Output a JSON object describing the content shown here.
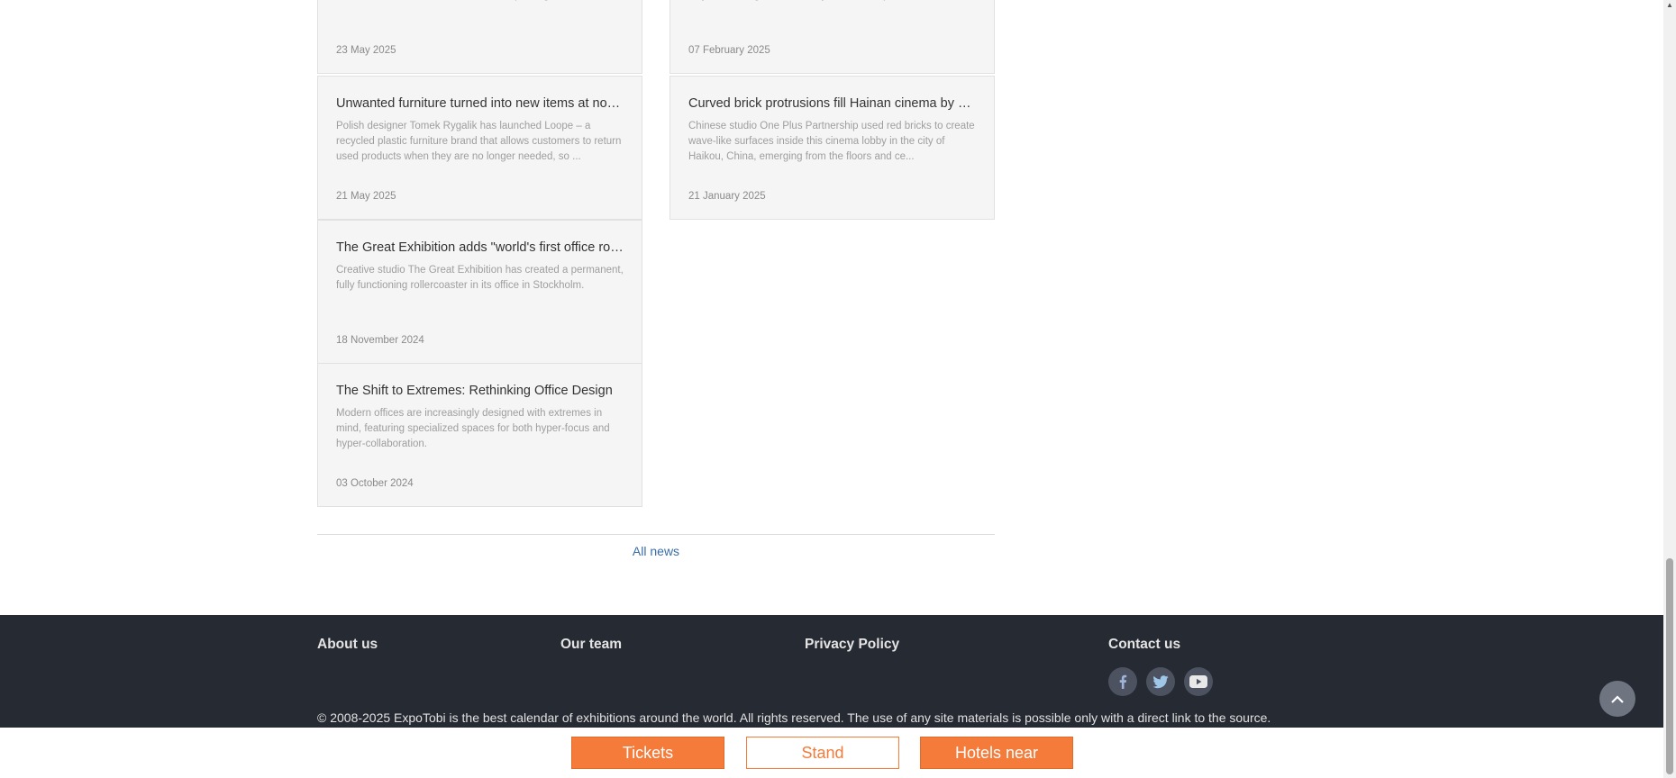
{
  "news": {
    "left_column": [
      {
        "title": "",
        "description": "built her \"plant pavilion,\" which she has turned into a guest bedroom at her summerhouse near Copenhagen.",
        "date": "23 May 2025"
      },
      {
        "title": "Unwanted furniture turned into new items at no e...",
        "description": "Polish designer Tomek Rygalik has launched Loope – a recycled plastic furniture brand that allows customers to return used products when they are no longer needed, so ...",
        "date": "21 May 2025"
      },
      {
        "title": "The Great Exhibition adds \"world's first office rolle...",
        "description": "Creative studio The Great Exhibition has created a permanent, fully functioning rollercoaster in its office in Stockholm.",
        "date": "18 November 2024"
      },
      {
        "title": "The Shift to Extremes: Rethinking Office Design",
        "description": "Modern offices are increasingly designed with extremes in mind, featuring specialized spaces for both hyper-focus and hyper-collaboration.",
        "date": "03 October 2024"
      }
    ],
    "right_column": [
      {
        "title": "",
        "description": "with digital technology and alternative materials to invent new ways of making furniture. Amy Frearson reports.",
        "date": "07 February 2025"
      },
      {
        "title": "Curved brick protrusions fill Hainan cinema by On...",
        "description": "Chinese studio One Plus Partnership used red bricks to create wave-like surfaces inside this cinema lobby in the city of Haikou, China, emerging from the floors and ce...",
        "date": "21 January 2025"
      }
    ],
    "all_news_label": "All news"
  },
  "footer": {
    "links": {
      "about": "About us",
      "team": "Our team",
      "privacy": "Privacy Policy",
      "contact": "Contact us"
    },
    "social_icons": [
      "facebook-icon",
      "twitter-icon",
      "youtube-icon"
    ],
    "copyright": "© 2008-2025 ExpoTobi is the best calendar of exhibitions around the world. All rights reserved. The use of any site materials is possible only with a direct link to the source."
  },
  "bottom_bar": {
    "tickets": "Tickets",
    "stand": "Stand",
    "hotels": "Hotels near"
  },
  "colors": {
    "accent": "#f47b3a",
    "footer_bg": "#262a33",
    "link": "#3a6da8"
  }
}
